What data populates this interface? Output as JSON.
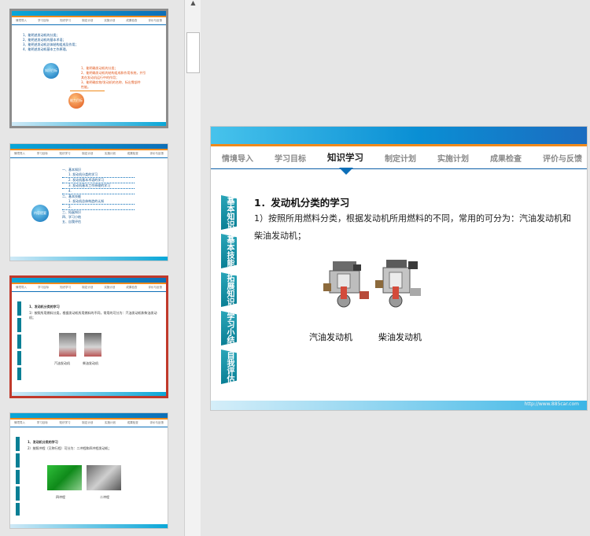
{
  "slide": {
    "nav": [
      "情境导入",
      "学习目标",
      "知识学习",
      "制定计划",
      "实施计划",
      "成果检查",
      "评价与反馈"
    ],
    "active_nav": "知识学习",
    "side_tabs": [
      "基本知识",
      "基本技能",
      "拓展知识",
      "学习小结",
      "自我评估"
    ],
    "heading": "1．发动机分类的学习",
    "paragraph": "1）按照所用燃料分类，根据发动机所用燃料的不同，常用的可分为：汽油发动机和柴油发动机；",
    "captions": [
      "汽油发动机",
      "柴油发动机"
    ],
    "footer_url": "http://www.885car.com"
  },
  "thumbs": {
    "t1": {
      "lines": [
        "1、能明述发动机的分类；",
        "2、能明述发动机的基本术语；",
        "3、能明述发动机总体结构组成及作用；",
        "4、能明述发动机基本工作原理。"
      ],
      "badge1": "知识目标",
      "right_lines": [
        "1、能明确发动机的分类；",
        "2、能明确发动机的结构组成和作用系统，并引",
        "其在发动机运行中的作用；",
        "3、能明确实物/发动机的名称、标出零部件",
        "性能。"
      ],
      "badge2": "能力目标"
    },
    "t2": {
      "badge": "内容提要",
      "items": [
        "一、基本知识",
        "1. 发动机分类的学习",
        "2. 发动机基本术语的学习",
        "3. 发动机基本工作原理的学习",
        "4.",
        "二、基本技能",
        "1. 发动机总体构造的认知",
        "2.",
        "三、拓展知识",
        "四、学习小结",
        "五、自我评估"
      ]
    },
    "t3": {
      "heading": "1、发动机分类的学习",
      "text": "1）按照所用燃料分类，根据发动机所用燃料的不同，常用的可分为：汽油发动机和柴油发动机；",
      "captions": [
        "汽油发动机",
        "柴油发动机"
      ]
    },
    "t4": {
      "heading": "1、发动机分类的学习",
      "text": "2）按照冲程（又称行程）可分为：二冲程和四冲程发动机；",
      "captions": [
        "四冲程",
        "二冲程"
      ]
    }
  },
  "colors": {
    "accent": "#0d6fb8",
    "orange": "#f08a1c",
    "tab": "#0a7f95",
    "selected_border": "#c0392b"
  }
}
